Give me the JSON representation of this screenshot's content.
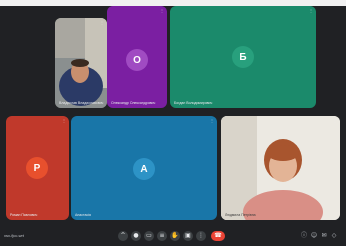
{
  "meeting": {
    "code": "xsx-fjcc-wrt"
  },
  "participants": [
    {
      "name": "Владислав Владиславович",
      "type": "video",
      "label": ""
    },
    {
      "name": "Олександр Олександрович",
      "type": "avatar",
      "avatar_letter": "О",
      "color": "#7b1fa2"
    },
    {
      "name": "Богдан Володимирович",
      "type": "avatar",
      "avatar_letter": "Б",
      "color": "#1b8a6b"
    },
    {
      "name": "Роман Павлович",
      "type": "avatar",
      "avatar_letter": "Р",
      "color": "#d84315"
    },
    {
      "name": "Анастасія",
      "type": "avatar",
      "avatar_letter": "А",
      "color": "#1976a8"
    },
    {
      "name": "Людмила Петрівна",
      "type": "video",
      "label": ""
    }
  ],
  "controls": {
    "items": [
      {
        "icon": "chevron-up-icon",
        "glyph": "^"
      },
      {
        "icon": "microphone-icon",
        "glyph": "●"
      },
      {
        "icon": "camera-icon",
        "glyph": "▭"
      },
      {
        "icon": "captions-icon",
        "glyph": "≡"
      },
      {
        "icon": "raise-hand-icon",
        "glyph": "✋"
      },
      {
        "icon": "present-icon",
        "glyph": "▣"
      },
      {
        "icon": "more-options-icon",
        "glyph": "⋮"
      }
    ],
    "end_call": {
      "icon": "end-call-icon",
      "glyph": "☎"
    }
  },
  "right_icons": [
    {
      "icon": "info-icon",
      "glyph": "ⓘ"
    },
    {
      "icon": "people-icon",
      "glyph": "☺"
    },
    {
      "icon": "chat-icon",
      "glyph": "✉"
    },
    {
      "icon": "activities-icon",
      "glyph": "◇"
    }
  ],
  "colors": {
    "background": "#202124",
    "end_call": "#ea4335"
  }
}
